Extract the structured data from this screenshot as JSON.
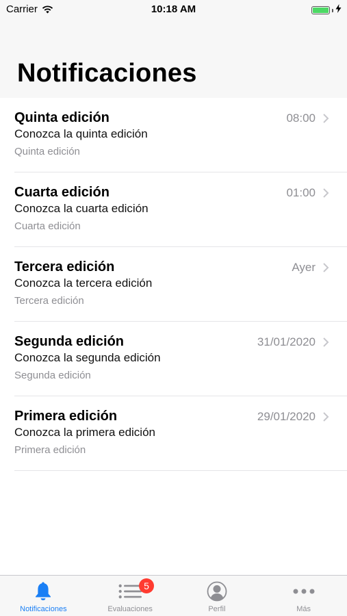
{
  "status_bar": {
    "carrier": "Carrier",
    "time": "10:18 AM",
    "battery_level": 1.0
  },
  "header": {
    "title": "Notificaciones"
  },
  "notifications": [
    {
      "title": "Quinta edición",
      "body": "Conozca la quinta edición",
      "tag": "Quinta edición",
      "date": "08:00"
    },
    {
      "title": "Cuarta edición",
      "body": "Conozca la cuarta edición",
      "tag": "Cuarta edición",
      "date": "01:00"
    },
    {
      "title": "Tercera edición",
      "body": "Conozca la tercera edición",
      "tag": "Tercera edición",
      "date": "Ayer"
    },
    {
      "title": "Segunda edición",
      "body": "Conozca la segunda edición",
      "tag": "Segunda edición",
      "date": "31/01/2020"
    },
    {
      "title": "Primera edición",
      "body": "Conozca la primera edición",
      "tag": "Primera edición",
      "date": "29/01/2020"
    }
  ],
  "tab_bar": {
    "tabs": [
      {
        "label": "Notificaciones",
        "icon": "bell-icon",
        "active": true
      },
      {
        "label": "Evaluaciones",
        "icon": "list-icon",
        "active": false,
        "badge": "5"
      },
      {
        "label": "Perfil",
        "icon": "person-icon",
        "active": false
      },
      {
        "label": "Más",
        "icon": "more-icon",
        "active": false
      }
    ]
  },
  "colors": {
    "accent": "#1a7ff5",
    "badge": "#ff3b30",
    "secondary_text": "#8e8e93",
    "battery": "#4cd964"
  }
}
